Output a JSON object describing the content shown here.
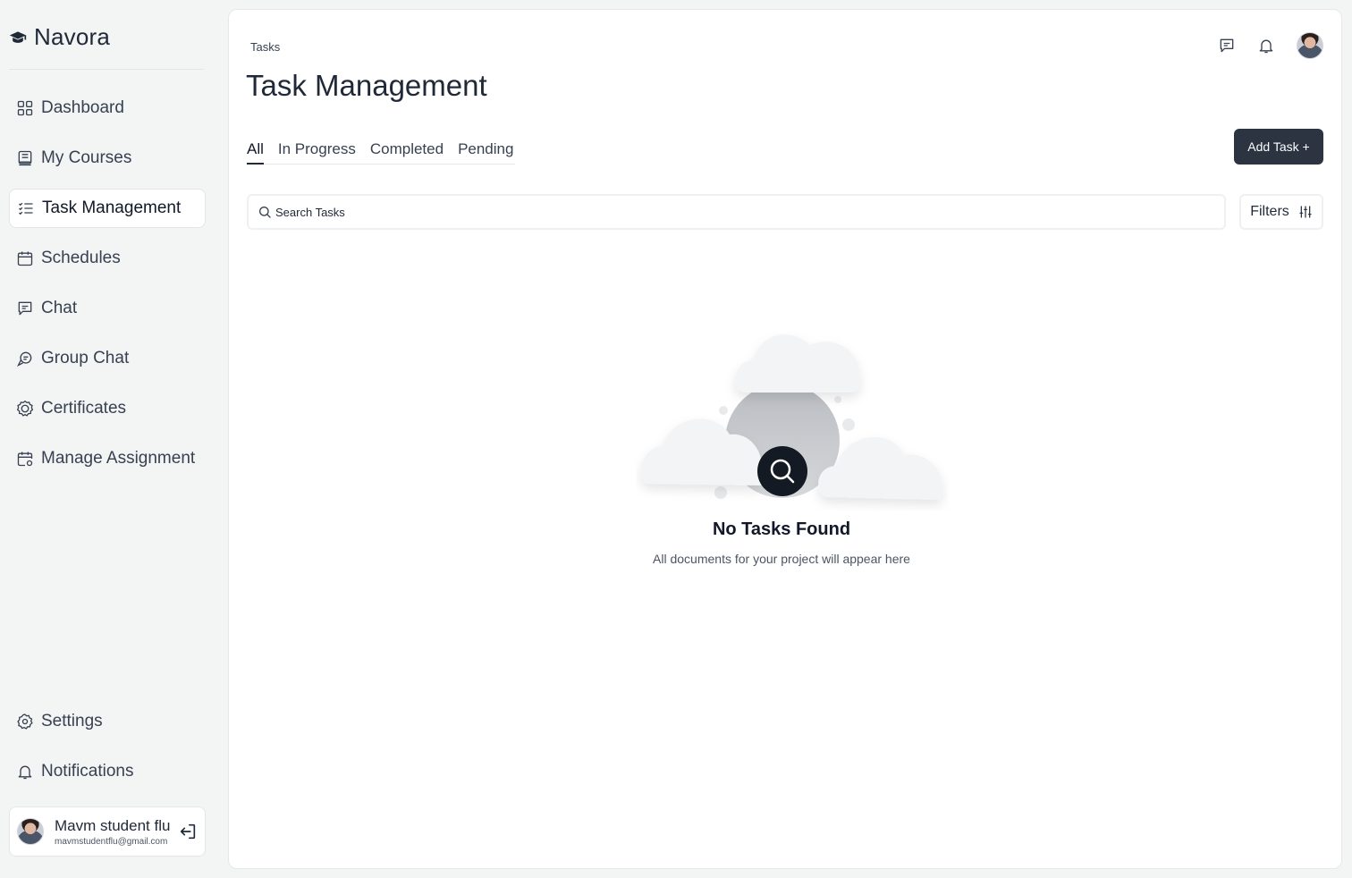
{
  "app": {
    "name": "Navora"
  },
  "sidebar": {
    "items": [
      {
        "label": "Dashboard",
        "icon": "grid-icon"
      },
      {
        "label": "My Courses",
        "icon": "book-icon"
      },
      {
        "label": "Task Management",
        "icon": "checklist-icon",
        "active": true
      },
      {
        "label": "Schedules",
        "icon": "calendar-icon"
      },
      {
        "label": "Chat",
        "icon": "chat-icon"
      },
      {
        "label": "Group Chat",
        "icon": "group-chat-icon"
      },
      {
        "label": "Certificates",
        "icon": "badge-icon"
      },
      {
        "label": "Manage Assignment",
        "icon": "calendar-edit-icon"
      }
    ],
    "bottom_items": [
      {
        "label": "Settings",
        "icon": "gear-icon"
      },
      {
        "label": "Notifications",
        "icon": "bell-icon"
      }
    ],
    "user": {
      "name": "Mavm student flu",
      "email": "mavmstudentflu@gmail.com"
    }
  },
  "main": {
    "breadcrumb": "Tasks",
    "title": "Task Management",
    "tabs": [
      {
        "label": "All",
        "active": true
      },
      {
        "label": "In Progress"
      },
      {
        "label": "Completed"
      },
      {
        "label": "Pending"
      }
    ],
    "add_button": "Add Task +",
    "search": {
      "placeholder": "Search Tasks",
      "value": ""
    },
    "filters_label": "Filters",
    "empty_state": {
      "title": "No Tasks Found",
      "subtitle": "All documents for your project will appear here"
    }
  },
  "colors": {
    "primary_button": "#2b3440",
    "page_bg": "#f3f4f4",
    "card_bg": "#ffffff"
  }
}
